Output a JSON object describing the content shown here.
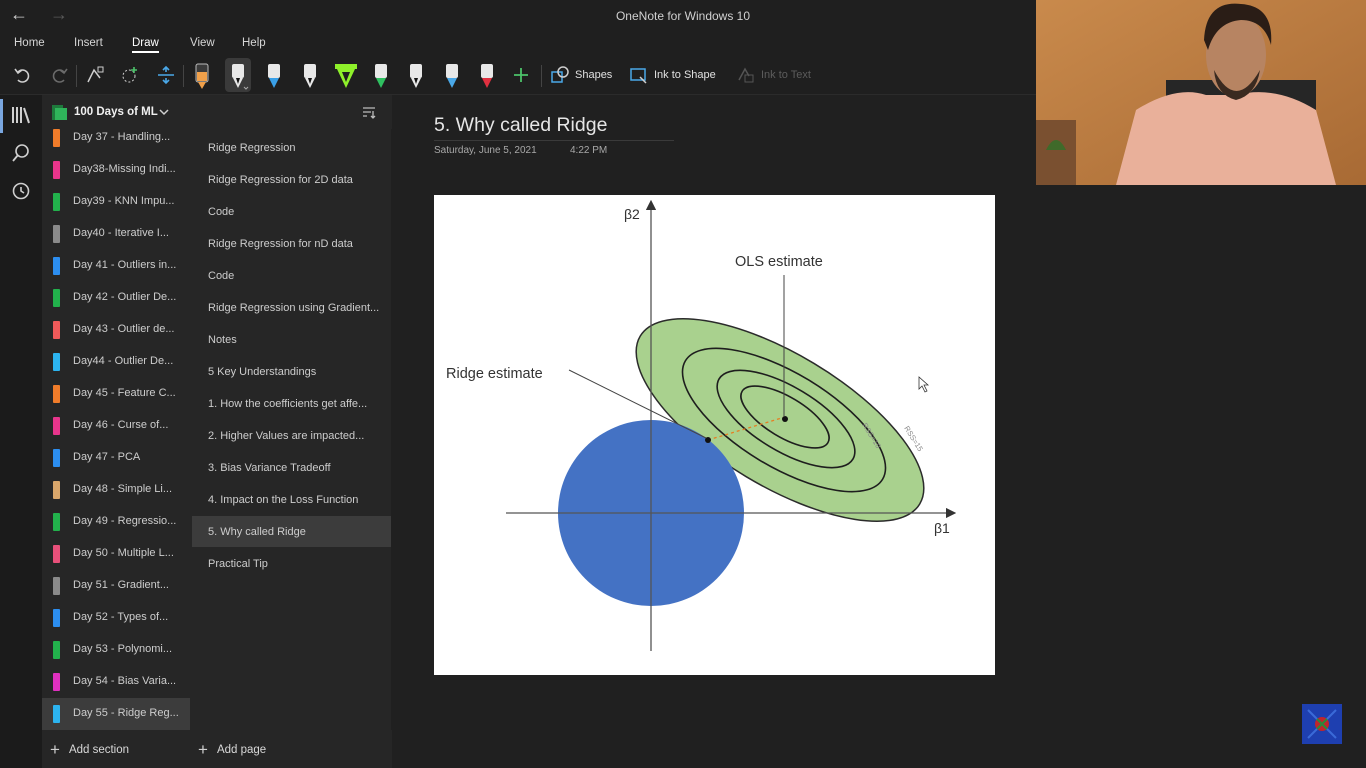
{
  "window": {
    "title": "OneNote for Windows 10",
    "back_glyph": "←",
    "forward_glyph": "→"
  },
  "menu": {
    "items": [
      "Home",
      "Insert",
      "Draw",
      "View",
      "Help"
    ],
    "active": "Draw"
  },
  "ribbon": {
    "shapes_label": "Shapes",
    "ink_to_shape_label": "Ink to Shape",
    "ink_to_text_label": "Ink to Text",
    "pen_colors": [
      "#f0a04a",
      "#ffffff",
      "#3aa0e8",
      "#ffffff",
      "#8ef02a",
      "#2fc060",
      "#ffffff",
      "#4aa8e8",
      "#e03040"
    ]
  },
  "notebook": {
    "name": "100 Days of ML",
    "sections": [
      {
        "label": "Day 37 - Handling...",
        "color": "#f07c2a"
      },
      {
        "label": "Day38-Missing Indi...",
        "color": "#e8358c"
      },
      {
        "label": "Day39 - KNN Impu...",
        "color": "#22b14c"
      },
      {
        "label": "Day40 - Iterative I...",
        "color": "#8a8a8a"
      },
      {
        "label": "Day 41 - Outliers in...",
        "color": "#2c8ef0"
      },
      {
        "label": "Day 42 - Outlier De...",
        "color": "#22b14c"
      },
      {
        "label": "Day 43 - Outlier de...",
        "color": "#f05a5a"
      },
      {
        "label": "Day44 - Outlier De...",
        "color": "#2cb4f0"
      },
      {
        "label": "Day 45 - Feature C...",
        "color": "#f07c2a"
      },
      {
        "label": "Day 46 - Curse of...",
        "color": "#e8358c"
      },
      {
        "label": "Day 47 - PCA",
        "color": "#2c8ef0"
      },
      {
        "label": "Day 48 - Simple Li...",
        "color": "#d9a66b"
      },
      {
        "label": "Day 49 - Regressio...",
        "color": "#22b14c"
      },
      {
        "label": "Day 50 - Multiple L...",
        "color": "#e8507a"
      },
      {
        "label": "Day 51 - Gradient...",
        "color": "#8a8a8a"
      },
      {
        "label": "Day 52 - Types of...",
        "color": "#2c8ef0"
      },
      {
        "label": "Day 53 - Polynomi...",
        "color": "#22b14c"
      },
      {
        "label": "Day 54 - Bias Varia...",
        "color": "#e030c0"
      },
      {
        "label": "Day 55 - Ridge Reg...",
        "color": "#2cb4f0"
      }
    ],
    "selected_section": "Day 55 - Ridge Reg...",
    "add_section_label": "Add section"
  },
  "pages": {
    "items": [
      "Ridge Regression",
      "Ridge Regression for 2D data",
      "Code",
      "Ridge Regression for nD data",
      "Code",
      "Ridge Regression using Gradient...",
      "Notes",
      "5 Key Understandings",
      "1. How the coefficients get affe...",
      "2. Higher Values are impacted...",
      "3. Bias Variance Tradeoff",
      "4. Impact on the Loss Function",
      "5. Why called Ridge",
      "Practical Tip"
    ],
    "selected": "5. Why called Ridge",
    "add_page_label": "Add page"
  },
  "page": {
    "title": "5. Why called Ridge",
    "date": "Saturday, June 5, 2021",
    "time": "4:22 PM"
  },
  "figure": {
    "ylabel": "β2",
    "xlabel": "β1",
    "ols_label": "OLS estimate",
    "ridge_label": "Ridge estimate",
    "contour_label_inner": "RSS=10",
    "contour_label_outer": "RSS=15",
    "circle_color": "#4472c4",
    "ellipse_color": "#a9d18e"
  }
}
